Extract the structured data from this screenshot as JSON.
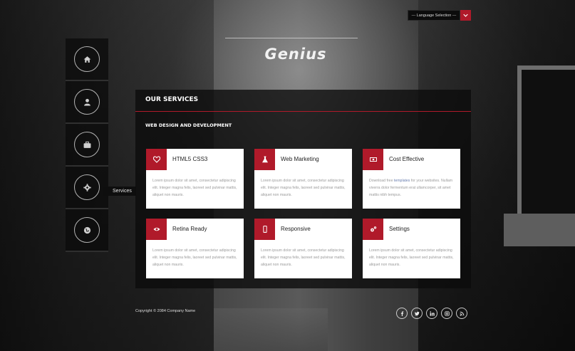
{
  "language_selector": {
    "value": "--- Language Selection ---"
  },
  "header": {
    "logo": "Genius"
  },
  "sidenav": {
    "items": [
      {
        "icon": "home-icon"
      },
      {
        "icon": "user-icon"
      },
      {
        "icon": "briefcase-icon"
      },
      {
        "icon": "gear-icon",
        "tooltip": "Services"
      },
      {
        "icon": "globe-icon"
      }
    ]
  },
  "panel": {
    "title": "OUR SERVICES",
    "subtitle": "WEB DESIGN AND DEVELOPMENT",
    "accent_color": "#b01a2a",
    "cards": [
      {
        "icon": "heart-icon",
        "title": "HTML5 CSS3",
        "desc": "Lorem ipsum dolor sit amet, consectetur adipiscing elit. Integer magna felis, laoreet sed pulvinar mattis, aliquet non mauris."
      },
      {
        "icon": "flask-icon",
        "title": "Web Marketing",
        "desc": "Lorem ipsum dolor sit amet, consectetur adipiscing elit. Integer magna felis, laoreet sed pulvinar mattis, aliquet non mauris."
      },
      {
        "icon": "money-icon",
        "title": "Cost Effective",
        "desc_pre": "Download free ",
        "desc_link": "templates",
        "desc_post": " for your websites. Nullam viverra dolor fermentum erat ullamcorper, sit amet mattis nibh tempus."
      },
      {
        "icon": "eye-icon",
        "title": "Retina Ready",
        "desc": "Lorem ipsum dolor sit amet, consectetur adipiscing elit. Integer magna felis, laoreet sed pulvinar mattis, aliquet non mauris."
      },
      {
        "icon": "mobile-icon",
        "title": "Responsive",
        "desc": "Lorem ipsum dolor sit amet, consectetur adipiscing elit. Integer magna felis, laoreet sed pulvinar mattis, aliquet non mauris."
      },
      {
        "icon": "cogs-icon",
        "title": "Settings",
        "desc": "Lorem ipsum dolor sit amet, consectetur adipiscing elit. Integer magna felis, laoreet sed pulvinar mattis, aliquet non mauris."
      }
    ]
  },
  "footer": {
    "copyright": "Copyright © 2084 Company Name",
    "social": [
      "facebook-icon",
      "twitter-icon",
      "linkedin-icon",
      "instagram-icon",
      "rss-icon"
    ]
  }
}
